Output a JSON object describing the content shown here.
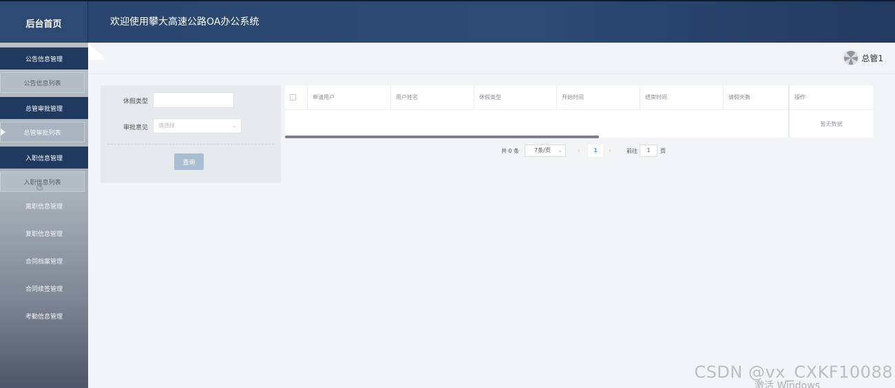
{
  "header": {
    "brand": "后台首页",
    "welcome": "欢迎使用攀大高速公路OA办公系统"
  },
  "sidebar": {
    "items": [
      {
        "label": "公告信息管理",
        "kind": "head"
      },
      {
        "label": "公告信息列表",
        "kind": "sub"
      },
      {
        "label": "总管审批管理",
        "kind": "head"
      },
      {
        "label": "总管审批列表",
        "kind": "sub",
        "active": true
      },
      {
        "label": "入职信息管理",
        "kind": "head"
      },
      {
        "label": "入职信息列表",
        "kind": "sub"
      },
      {
        "label": "离职信息管理",
        "kind": "plain"
      },
      {
        "label": "复职信息管理",
        "kind": "plain"
      },
      {
        "label": "合同档案管理",
        "kind": "plain"
      },
      {
        "label": "合同续签管理",
        "kind": "plain"
      },
      {
        "label": "考勤信息管理",
        "kind": "plain"
      }
    ]
  },
  "user": {
    "name": "总管1",
    "avatar_icon": "avatar-icon"
  },
  "search": {
    "leave_type_label": "休假类型",
    "leave_type_value": "",
    "approval_label": "审批意见",
    "approval_placeholder": "请选择",
    "query_button": "查询"
  },
  "table": {
    "columns": [
      "申请用户",
      "用户姓名",
      "休假类型",
      "开始时间",
      "结束时间",
      "请假天数",
      "操作"
    ],
    "empty_text": "暂无数据"
  },
  "pagination": {
    "total": "共 0 条",
    "page_size": "7条/页",
    "current_page": "1",
    "goto_label": "前往",
    "goto_value": "1",
    "page_word": "页"
  },
  "watermark": {
    "csdn": "CSDN @vx_CXKF10088",
    "windows": "激活 Windows"
  },
  "colors": {
    "header": "#2a466f",
    "menu_head": "#1f3a5e",
    "query_button": "#a9bdd3",
    "active_page": "#409eff"
  }
}
